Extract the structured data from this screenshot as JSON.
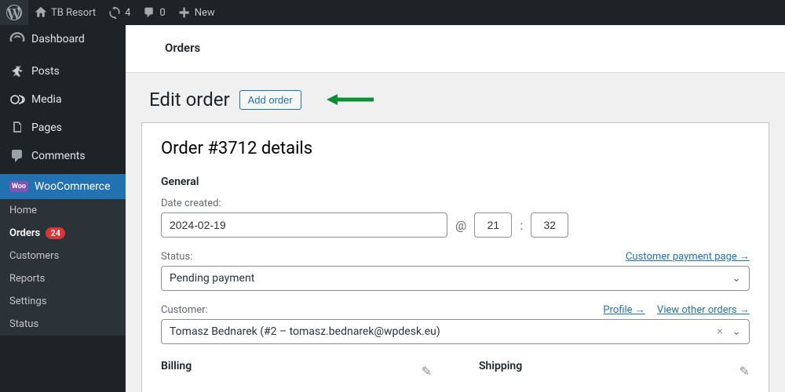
{
  "adminbar": {
    "site_name": "TB Resort",
    "updates": "4",
    "comments": "0",
    "new": "New"
  },
  "sidebar": {
    "dashboard": "Dashboard",
    "posts": "Posts",
    "media": "Media",
    "pages": "Pages",
    "comments": "Comments",
    "woocommerce": "WooCommerce",
    "submenu": {
      "home": "Home",
      "orders": "Orders",
      "orders_count": "24",
      "customers": "Customers",
      "reports": "Reports",
      "settings": "Settings",
      "status": "Status"
    }
  },
  "breadcrumb": "Orders",
  "page_title": "Edit order",
  "add_order": "Add order",
  "panel": {
    "title": "Order #3712 details",
    "general": "General",
    "date_label": "Date created:",
    "date": "2024-02-19",
    "at": "@",
    "hour": "21",
    "colon": ":",
    "minute": "32",
    "status_label": "Status:",
    "status": "Pending payment",
    "payment_link": "Customer payment page →",
    "customer_label": "Customer:",
    "customer": "Tomasz Bednarek (#2 – tomasz.bednarek@wpdesk.eu)",
    "profile_link": "Profile →",
    "other_orders_link": "View other orders →",
    "billing": "Billing",
    "shipping": "Shipping"
  }
}
